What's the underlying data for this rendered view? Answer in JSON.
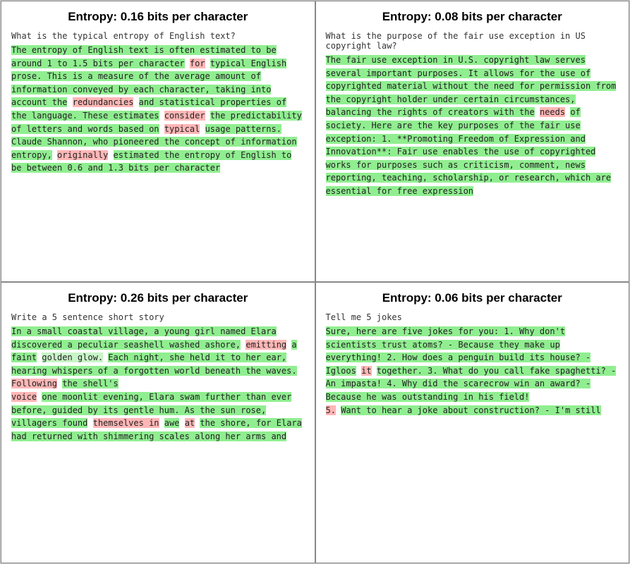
{
  "quadrants": [
    {
      "id": "q1",
      "title": "Entropy: 0.16 bits per character",
      "prompt": "What is the typical entropy of English\ntext?",
      "response_html": "<span class='hl-green'>The entropy of English text is often\nestimated to be around 1 to 1.5 bits per\ncharacter</span> <span class='hl-pink'>for</span> <span class='hl-green'>typical English prose. This\nis a measure of the average amount of\ninformation conveyed by each character,\ntaking into account the</span> <span class='hl-pink'>redundancies</span> <span class='hl-green'>and\nstatistical properties of the language.\nThese estimates</span> <span class='hl-pink'>consider</span> <span class='hl-green'>the\npredictability of letters and words based\non</span> <span class='hl-pink'>typical</span> <span class='hl-green'>usage patterns. Claude Shannon,\nwho pioneered the concept of information\nentropy,</span> <span class='hl-pink'>originally</span> <span class='hl-green'>estimated the entropy\nof English to be between 0.6 and 1.3 bits\nper character</span>"
    },
    {
      "id": "q2",
      "title": "Entropy: 0.08 bits per character",
      "prompt": "What is the purpose of the fair use\nexception in US copyright law?",
      "response_html": "<span class='hl-green'>The fair use exception in U.S. copyright\nlaw serves several important purposes. It\nallows for the use of copyrighted material\nwithout the need for permission from the\ncopyright holder under certain\ncircumstances, balancing the rights of\ncreators with the</span> <span class='hl-pink'>needs</span> <span class='hl-green'>of society. Here\nare the key purposes of the fair use\nexception:\n1. **Promoting Freedom of Expression and\nInnovation**: Fair use enables the use of\ncopyrighted works for purposes such as\ncriticism, comment, news reporting,\nteaching, scholarship, or research, which\nare essential for free expression</span>"
    },
    {
      "id": "q3",
      "title": "Entropy: 0.26 bits per character",
      "prompt": "Write a 5 sentence short story",
      "response_html": "<span class='hl-green'>In a small coastal village, a young girl\nnamed Elara discovered a peculiar seashell\nwashed ashore,</span> <span class='hl-pink'>emitting</span> <span class='hl-green'>a faint</span> <span class='hl-light-green'>golden\nglow.</span> <span class='hl-green'>Each night, she held it to her ear,\nhearing whispers of a forgotten world\nbeneath the waves.</span> <span class='hl-pink'>Following</span> <span class='hl-green'>the shell's</span>\n<span class='hl-pink'>voice</span> <span class='hl-green'>one moonlit evening, Elara swam\nfurther than ever before, guided by its\ngentle hum. As the sun rose, villagers\nfound</span> <span class='hl-pink'>themselves in</span> <span class='hl-green'>awe</span> <span class='hl-pink'>at</span> <span class='hl-green'>the shore, for\nElara had returned with shimmering scales\nalong her arms and</span>"
    },
    {
      "id": "q4",
      "title": "Entropy: 0.06 bits per character",
      "prompt": "Tell me 5 jokes",
      "response_html": "<span class='hl-green'>Sure, here are five jokes for you:\n1. Why don't scientists trust atoms?\n- Because they make up everything!\n2. How does a penguin build its house?\n- Igloos</span> <span class='hl-pink'>it</span> <span class='hl-green'>together.\n3. What do you call fake spaghetti?\n- An impasta!\n4. Why did the scarecrow win an award?\n- Because he was outstanding in his field!\n</span><span class='hl-pink'>5.</span> <span class='hl-green'>Want to hear a joke about construction?\n- I'm still</span>"
    }
  ]
}
